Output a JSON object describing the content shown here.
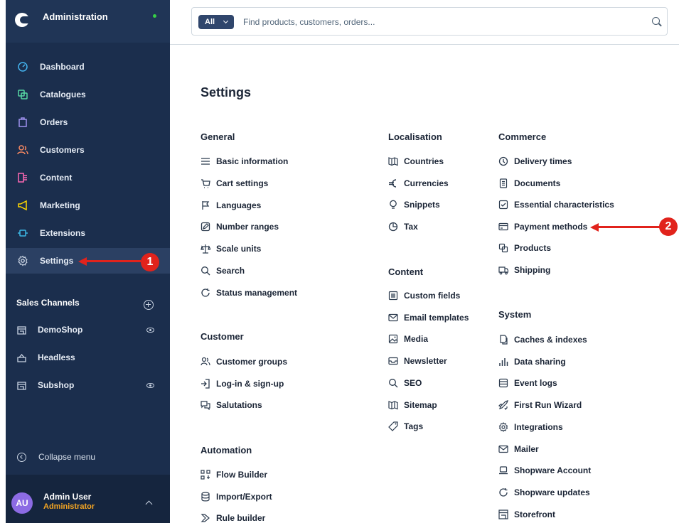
{
  "brand": {
    "title": "Administration"
  },
  "nav": [
    {
      "label": "Dashboard",
      "icon": "dashboard-icon"
    },
    {
      "label": "Catalogues",
      "icon": "catalogues-icon"
    },
    {
      "label": "Orders",
      "icon": "orders-icon"
    },
    {
      "label": "Customers",
      "icon": "customers-icon"
    },
    {
      "label": "Content",
      "icon": "content-icon"
    },
    {
      "label": "Marketing",
      "icon": "marketing-icon"
    },
    {
      "label": "Extensions",
      "icon": "extensions-icon"
    },
    {
      "label": "Settings",
      "icon": "gear-icon"
    }
  ],
  "sales_channels": {
    "title": "Sales Channels",
    "items": [
      {
        "label": "DemoShop"
      },
      {
        "label": "Headless"
      },
      {
        "label": "Subshop"
      }
    ]
  },
  "collapse": {
    "label": "Collapse menu"
  },
  "user": {
    "initials": "AU",
    "name": "Admin User",
    "role": "Administrator"
  },
  "search": {
    "scope": "All",
    "placeholder": "Find products, customers, orders..."
  },
  "settings": {
    "title": "Settings",
    "general": {
      "title": "General",
      "items": [
        "Basic information",
        "Cart settings",
        "Languages",
        "Number ranges",
        "Scale units",
        "Search",
        "Status management"
      ]
    },
    "customer": {
      "title": "Customer",
      "items": [
        "Customer groups",
        "Log-in & sign-up",
        "Salutations"
      ]
    },
    "automation": {
      "title": "Automation",
      "items": [
        "Flow Builder",
        "Import/Export",
        "Rule builder"
      ]
    },
    "localisation": {
      "title": "Localisation",
      "items": [
        "Countries",
        "Currencies",
        "Snippets",
        "Tax"
      ]
    },
    "content": {
      "title": "Content",
      "items": [
        "Custom fields",
        "Email templates",
        "Media",
        "Newsletter",
        "SEO",
        "Sitemap",
        "Tags"
      ]
    },
    "commerce": {
      "title": "Commerce",
      "items": [
        "Delivery times",
        "Documents",
        "Essential characteristics",
        "Payment methods",
        "Products",
        "Shipping"
      ]
    },
    "system": {
      "title": "System",
      "items": [
        "Caches & indexes",
        "Data sharing",
        "Event logs",
        "First Run Wizard",
        "Integrations",
        "Mailer",
        "Shopware Account",
        "Shopware updates",
        "Storefront"
      ]
    }
  },
  "annotations": {
    "badge_1": "1",
    "badge_2": "2"
  },
  "colors": {
    "sidebar": "#1b2e4d",
    "accent": "#e1231c",
    "active": "#2b4063"
  }
}
